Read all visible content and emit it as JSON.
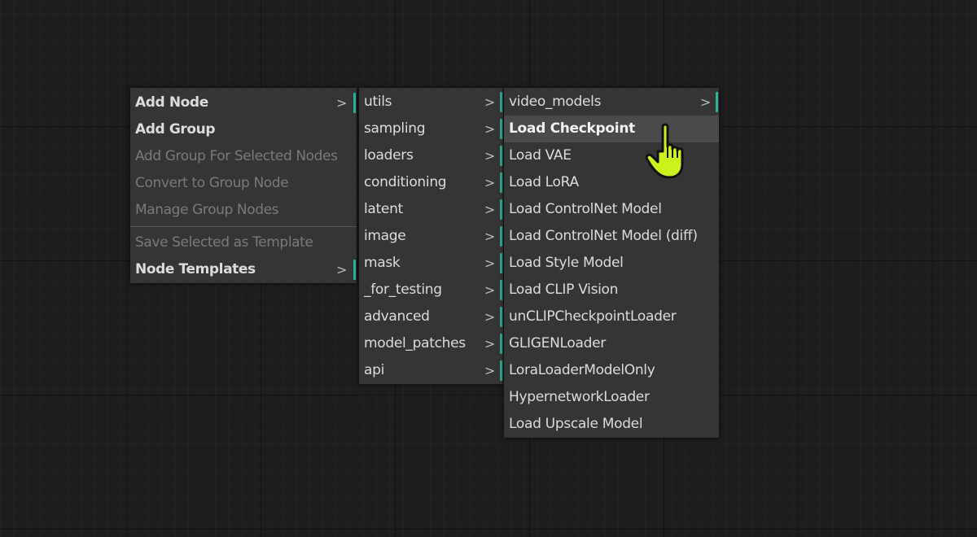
{
  "menus": {
    "main": {
      "items": [
        {
          "label": "Add Node",
          "disabled": false,
          "submenu": true
        },
        {
          "label": "Add Group",
          "disabled": false,
          "submenu": false
        },
        {
          "label": "Add Group For Selected Nodes",
          "disabled": true,
          "submenu": false
        },
        {
          "label": "Convert to Group Node",
          "disabled": true,
          "submenu": false
        },
        {
          "label": "Manage Group Nodes",
          "disabled": true,
          "submenu": false
        },
        {
          "label": "Save Selected as Template",
          "disabled": true,
          "submenu": false
        },
        {
          "label": "Node Templates",
          "disabled": false,
          "submenu": true
        }
      ]
    },
    "categories": {
      "items": [
        {
          "label": "utils",
          "submenu": true
        },
        {
          "label": "sampling",
          "submenu": true
        },
        {
          "label": "loaders",
          "submenu": true
        },
        {
          "label": "conditioning",
          "submenu": true
        },
        {
          "label": "latent",
          "submenu": true
        },
        {
          "label": "image",
          "submenu": true
        },
        {
          "label": "mask",
          "submenu": true
        },
        {
          "label": "_for_testing",
          "submenu": true
        },
        {
          "label": "advanced",
          "submenu": true
        },
        {
          "label": "model_patches",
          "submenu": true
        },
        {
          "label": "api",
          "submenu": true
        }
      ]
    },
    "loaders": {
      "items": [
        {
          "label": "video_models",
          "submenu": true,
          "highlighted": false
        },
        {
          "label": "Load Checkpoint",
          "submenu": false,
          "highlighted": true
        },
        {
          "label": "Load VAE",
          "submenu": false
        },
        {
          "label": "Load LoRA",
          "submenu": false
        },
        {
          "label": "Load ControlNet Model",
          "submenu": false
        },
        {
          "label": "Load ControlNet Model (diff)",
          "submenu": false
        },
        {
          "label": "Load Style Model",
          "submenu": false
        },
        {
          "label": "Load CLIP Vision",
          "submenu": false
        },
        {
          "label": "unCLIPCheckpointLoader",
          "submenu": false
        },
        {
          "label": "GLIGENLoader",
          "submenu": false
        },
        {
          "label": "LoraLoaderModelOnly",
          "submenu": false
        },
        {
          "label": "HypernetworkLoader",
          "submenu": false
        },
        {
          "label": "Load Upscale Model",
          "submenu": false
        }
      ]
    }
  },
  "submenu_arrow": ">",
  "colors": {
    "accent": "#2db49a",
    "cursor": "#ccf21e",
    "menu_bg": "#353535",
    "canvas_bg": "#1d1d1d"
  },
  "icons": {
    "cursor": "hand-pointer-icon"
  }
}
